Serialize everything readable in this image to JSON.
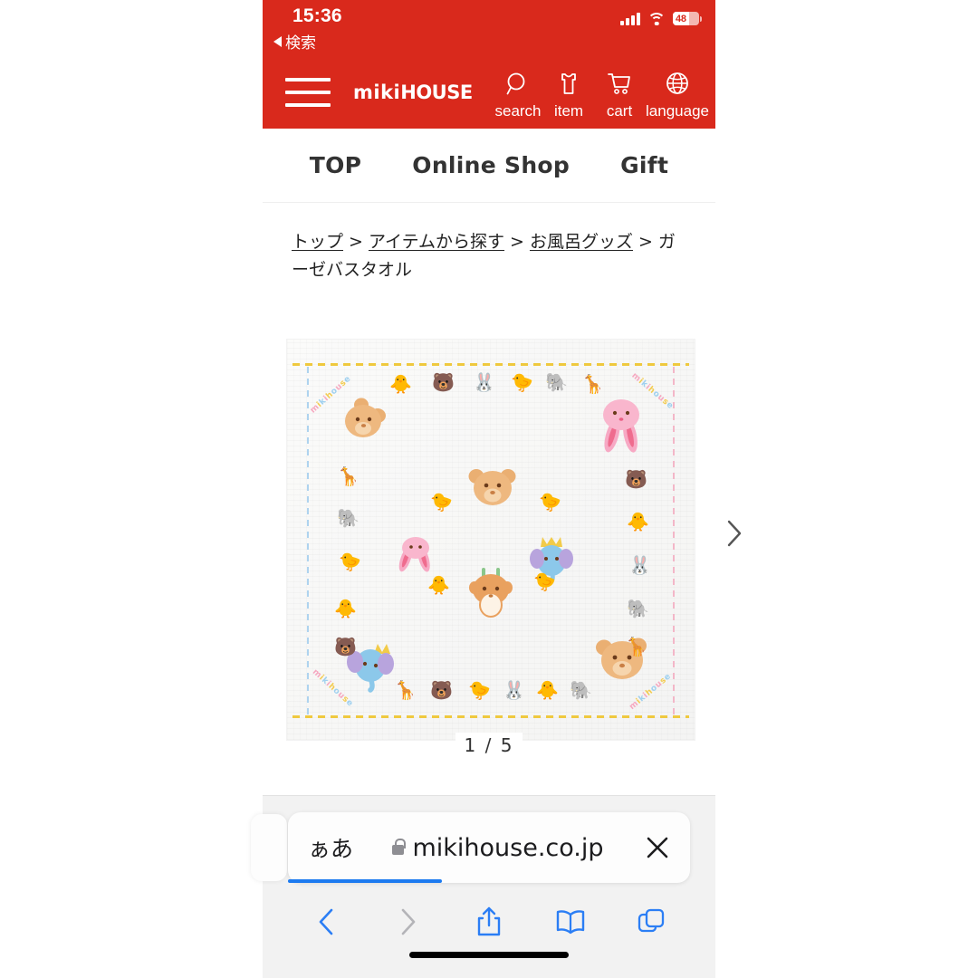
{
  "status_bar": {
    "time": "15:36",
    "back_label": "検索",
    "battery_percent": "48",
    "signal_icon": "cellular-bars-icon",
    "wifi_icon": "wifi-icon",
    "battery_icon": "battery-icon"
  },
  "site_header": {
    "menu_icon": "hamburger-menu-icon",
    "brand_lower": "miki",
    "brand_upper": "HOUSE",
    "background_color": "#d9291c",
    "icons": [
      {
        "name": "search-icon",
        "label": "search"
      },
      {
        "name": "tshirt-item-icon",
        "label": "item"
      },
      {
        "name": "shopping-cart-icon",
        "label": "cart"
      },
      {
        "name": "globe-language-icon",
        "label": "language"
      }
    ]
  },
  "nav_tabs": [
    {
      "label": "TOP"
    },
    {
      "label": "Online Shop"
    },
    {
      "label": "Gift"
    }
  ],
  "breadcrumb": {
    "items": [
      {
        "label": "トップ",
        "link": true
      },
      {
        "label": "アイテムから探す",
        "link": true
      },
      {
        "label": "お風呂グッズ",
        "link": true
      },
      {
        "label": "ガーゼバスタオル",
        "link": false
      }
    ],
    "separator": ">"
  },
  "gallery": {
    "product_alt": "ガーゼバスタオル",
    "counter_current": "1",
    "counter_separator": "/",
    "counter_total": "5",
    "next_icon": "chevron-right-icon",
    "towel_brand_text": "mikihouse"
  },
  "safari": {
    "reader_label": "ぁあ",
    "lock_icon": "lock-icon",
    "url": "mikihouse.co.jp",
    "close_icon": "close-x-icon",
    "progress_color": "#1d7bf0",
    "toolbar": [
      {
        "name": "back-button",
        "icon": "chevron-left-icon",
        "enabled": true
      },
      {
        "name": "forward-button",
        "icon": "chevron-right-icon",
        "enabled": false
      },
      {
        "name": "share-button",
        "icon": "share-up-arrow-icon",
        "enabled": true
      },
      {
        "name": "bookmarks-button",
        "icon": "open-book-icon",
        "enabled": true
      },
      {
        "name": "tabs-button",
        "icon": "two-squares-tabs-icon",
        "enabled": true
      }
    ]
  }
}
